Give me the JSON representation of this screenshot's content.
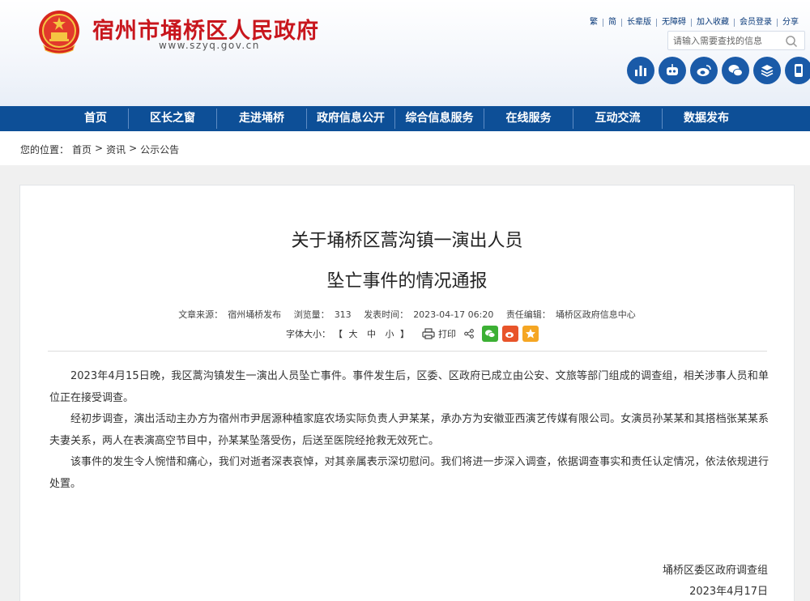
{
  "header": {
    "site_title": "宿州市埇桥区人民政府",
    "site_url": "www.szyq.gov.cn",
    "toplinks": [
      "繁",
      "简",
      "长辈版",
      "无障碍",
      "加入收藏",
      "会员登录",
      "分享"
    ],
    "search_placeholder": "请输入需要查找的信息",
    "social_icons": [
      "stats-icon",
      "robot-icon",
      "weibo-icon",
      "wechat-icon",
      "layers-icon",
      "app-icon"
    ],
    "colors": {
      "title_red": "#c8161d",
      "nav_blue": "#0d4f97",
      "icon_blue": "#1a5aa8"
    }
  },
  "nav": {
    "items": [
      "首页",
      "区长之窗",
      "走进埇桥",
      "政府信息公开",
      "综合信息服务",
      "在线服务",
      "互动交流",
      "数据发布"
    ]
  },
  "breadcrumb": {
    "prefix": "您的位置：",
    "items": [
      "首页",
      "资讯",
      "公示公告"
    ],
    "separator": ">"
  },
  "article": {
    "title_line1": "关于埇桥区蒿沟镇一演出人员",
    "title_line2": "坠亡事件的情况通报",
    "meta": {
      "source_label": "文章来源：",
      "source": "宿州埇桥发布",
      "views_label": "浏览量：",
      "views": "313",
      "time_label": "发表时间：",
      "time": "2023-04-17 06:20",
      "editor_label": "责任编辑：",
      "editor": "埇桥区政府信息中心"
    },
    "tools": {
      "font_label": "字体大小：",
      "bracket_open": "【",
      "big": "大",
      "mid": "中",
      "small": "小",
      "bracket_close": "】",
      "print": "打印"
    },
    "paragraphs": [
      "2023年4月15日晚，我区蒿沟镇发生一演出人员坠亡事件。事件发生后，区委、区政府已成立由公安、文旅等部门组成的调查组，相关涉事人员和单位正在接受调查。",
      "经初步调查，演出活动主办方为宿州市尹居源种植家庭农场实际负责人尹某某，承办方为安徽亚西演艺传媒有限公司。女演员孙某某和其搭档张某某系夫妻关系，两人在表演高空节目中，孙某某坠落受伤，后送至医院经抢救无效死亡。",
      "该事件的发生令人惋惜和痛心，我们对逝者深表哀悼，对其亲属表示深切慰问。我们将进一步深入调查，依据调查事实和责任认定情况，依法依规进行处置。"
    ],
    "signature": "埇桥区委区政府调查组",
    "date": "2023年4月17日"
  }
}
